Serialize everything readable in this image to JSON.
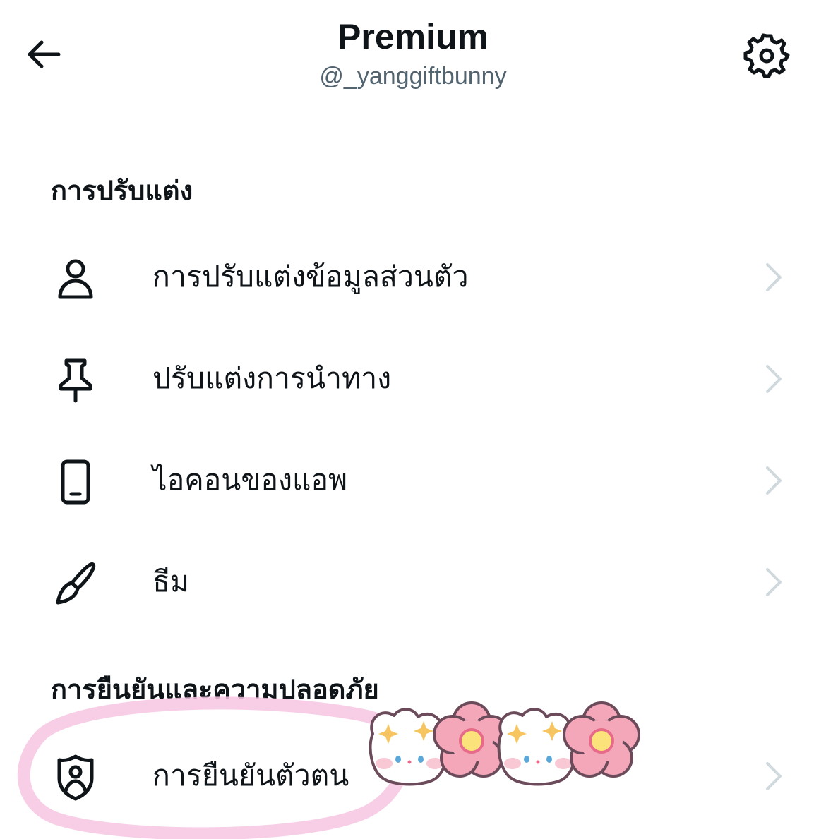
{
  "header": {
    "title": "Premium",
    "handle": "@_yanggiftbunny",
    "back_icon": "arrow-left-icon",
    "settings_icon": "gear-icon"
  },
  "sections": [
    {
      "heading": "การปรับแต่ง",
      "items": [
        {
          "label": "การปรับแต่งข้อมูลส่วนตัว",
          "icon": "person-icon"
        },
        {
          "label": "ปรับแต่งการนำทาง",
          "icon": "pin-icon"
        },
        {
          "label": "ไอคอนของแอพ",
          "icon": "phone-icon"
        },
        {
          "label": "ธีม",
          "icon": "brush-icon"
        }
      ]
    },
    {
      "heading": "การยืนยันและความปลอดภัย",
      "items": [
        {
          "label": "การยืนยันตัวตน",
          "icon": "shield-person-icon"
        }
      ]
    }
  ],
  "colors": {
    "text_primary": "#0f1419",
    "text_secondary": "#536471",
    "chevron": "#cfd9de",
    "highlight_ring": "#f7c6e3",
    "sticker_pink": "#f4a7b9"
  }
}
